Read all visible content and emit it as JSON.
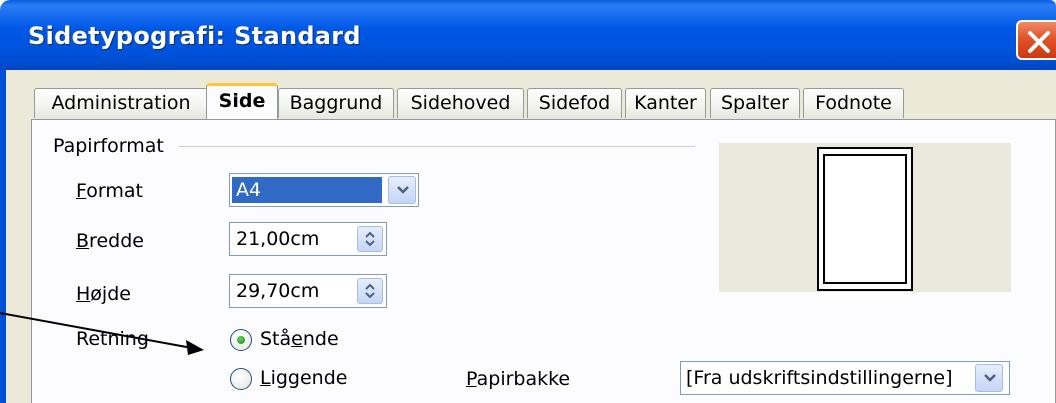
{
  "window": {
    "title": "Sidetypografi: Standard"
  },
  "tabs": [
    {
      "label": "Administration",
      "active": false
    },
    {
      "label": "Side",
      "active": true
    },
    {
      "label": "Baggrund",
      "active": false
    },
    {
      "label": "Sidehoved",
      "active": false
    },
    {
      "label": "Sidefod",
      "active": false
    },
    {
      "label": "Kanter",
      "active": false
    },
    {
      "label": "Spalter",
      "active": false
    },
    {
      "label": "Fodnote",
      "active": false
    }
  ],
  "paper_format": {
    "group_label": "Papirformat",
    "format": {
      "label_first": "F",
      "label_rest": "ormat",
      "value": "A4"
    },
    "width": {
      "label_first": "B",
      "label_rest": "redde",
      "value": "21,00cm"
    },
    "height": {
      "label_first": "H",
      "label_rest": "øjde",
      "value": "29,70cm"
    },
    "orientation": {
      "label": "Retning",
      "portrait": {
        "label_pre": "Stå",
        "label_u": "e",
        "label_post": "nde",
        "checked": true
      },
      "landscape": {
        "label_u": "L",
        "label_post": "iggende",
        "checked": false
      }
    },
    "paper_tray": {
      "label_u": "P",
      "label_post": "apirbakke",
      "value": "[Fra udskriftsindstillingerne]"
    }
  },
  "colors": {
    "titlebar": "#0058e6",
    "selection": "#316ac5",
    "active_tab_accent": "#ffc83c",
    "dialog_bg": "#ece9d8",
    "close_button": "#e2532a"
  }
}
